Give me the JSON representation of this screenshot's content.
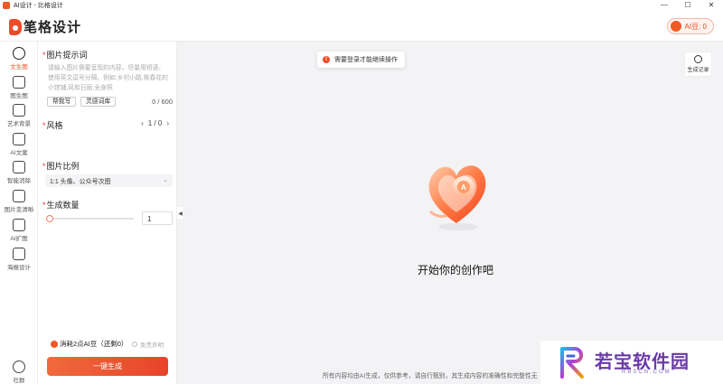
{
  "window": {
    "title": "AI设计 - 比格设计",
    "controls": {
      "minimize": "—",
      "maximize": "☐",
      "close": "✕"
    }
  },
  "header": {
    "logo_text": "笔格设计",
    "coins_label": "AI豆: 0"
  },
  "leftnav": {
    "items": [
      {
        "label": "文生图",
        "icon": "chat-bubble-icon",
        "active": true
      },
      {
        "label": "图生图",
        "icon": "image-transform-icon"
      },
      {
        "label": "艺术背景",
        "icon": "landscape-icon"
      },
      {
        "label": "AI文案",
        "icon": "document-ai-icon"
      },
      {
        "label": "智能消除",
        "icon": "erase-icon"
      },
      {
        "label": "图片变清晰",
        "icon": "enhance-icon"
      },
      {
        "label": "AI扩图",
        "icon": "expand-icon"
      },
      {
        "label": "海报设计",
        "icon": "pen-icon"
      }
    ],
    "community_label": "社群"
  },
  "panel": {
    "prompt": {
      "title": "图片提示词",
      "placeholder": "请输入图片需要呈现的内容，尽量用短语、使用英文逗号分隔。例如:乡村小路,桃春花的小馆铺,风和日丽,全身照",
      "help_button": "帮我写",
      "inspire_button": "灵感词库",
      "counter": "0 / 600"
    },
    "style": {
      "title": "风格",
      "pager": "1 / 0"
    },
    "ratio": {
      "title": "图片比例",
      "selected": "1:1 头像、公众号次图"
    },
    "count": {
      "title": "生成数量",
      "value": "1",
      "slider_value": 0
    },
    "cost_label": "消耗2点AI豆（还剩0）",
    "agree_label": "免责声明",
    "generate_button": "一键生成"
  },
  "main": {
    "toast": "需要登录才能继续操作",
    "history_button": "生成记录",
    "empty_title": "开始你的创作吧",
    "disclaimer": "所有内容均由AI生成，仅供参考，请自行甄别，其生成内容的准确性和完整性无"
  },
  "watermark": {
    "title": "若宝软件园",
    "subtitle": "RBSCN.COM"
  },
  "colors": {
    "accent": "#ee4b2b",
    "button_gradient_start": "#f06a3d",
    "button_gradient_end": "#e8432a",
    "watermark_purple": "#6a3aa8"
  }
}
